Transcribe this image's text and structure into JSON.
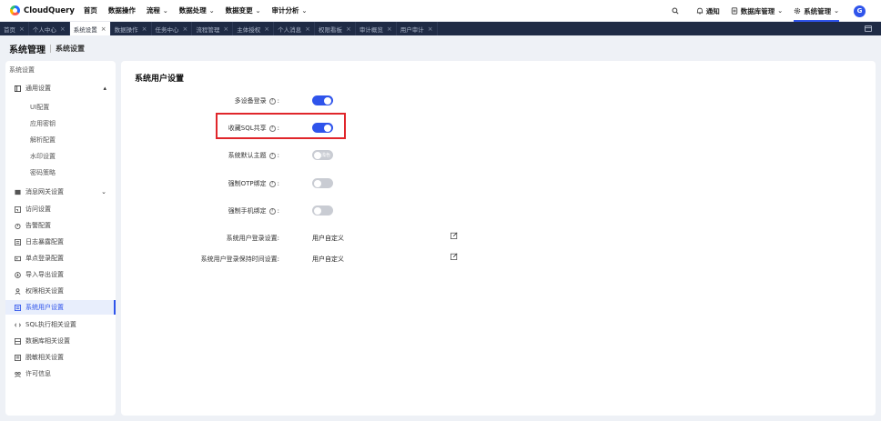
{
  "topnav": {
    "brand": "CloudQuery",
    "menu": [
      {
        "label": "首页",
        "caret": false
      },
      {
        "label": "数据操作",
        "caret": false
      },
      {
        "label": "流程",
        "caret": true
      },
      {
        "label": "数据处理",
        "caret": true
      },
      {
        "label": "数据变更",
        "caret": true
      },
      {
        "label": "审计分析",
        "caret": true
      }
    ],
    "notify": "通知",
    "db_manage": "数据库管理",
    "sys_manage": "系统管理",
    "avatar_letter": "G",
    "accent_color": "#2f54eb"
  },
  "tabs": [
    {
      "label": "首页",
      "active": false
    },
    {
      "label": "个人中心",
      "active": false
    },
    {
      "label": "系统设置",
      "active": true
    },
    {
      "label": "数据操作",
      "active": false
    },
    {
      "label": "任务中心",
      "active": false
    },
    {
      "label": "流程管理",
      "active": false
    },
    {
      "label": "主体授权",
      "active": false
    },
    {
      "label": "个人消息",
      "active": false
    },
    {
      "label": "权限看板",
      "active": false
    },
    {
      "label": "审计概览",
      "active": false
    },
    {
      "label": "用户审计",
      "active": false
    }
  ],
  "breadcrumb": {
    "section": "系统管理",
    "page": "系统设置"
  },
  "sidebar": {
    "title": "系统设置",
    "general": {
      "label": "通用设置",
      "expanded": true
    },
    "general_sub": [
      "UI配置",
      "应用密钥",
      "解析配置",
      "水印设置",
      "密码策略"
    ],
    "items": [
      {
        "label": "消息网关设置",
        "icon": "gateway-icon"
      },
      {
        "label": "访问设置",
        "icon": "access-icon"
      },
      {
        "label": "告警配置",
        "icon": "alarm-icon"
      },
      {
        "label": "日志暴露配置",
        "icon": "log-icon"
      },
      {
        "label": "单点登录配置",
        "icon": "sso-icon"
      },
      {
        "label": "导入导出设置",
        "icon": "import-export-icon"
      },
      {
        "label": "权限相关设置",
        "icon": "permission-icon"
      },
      {
        "label": "系统用户设置",
        "icon": "user-setting-icon",
        "active": true
      },
      {
        "label": "SQL执行相关设置",
        "icon": "sql-icon"
      },
      {
        "label": "数据库相关设置",
        "icon": "database-icon"
      },
      {
        "label": "脱敏相关设置",
        "icon": "desensitize-icon"
      },
      {
        "label": "许可信息",
        "icon": "license-icon"
      }
    ]
  },
  "main": {
    "title": "系统用户设置",
    "settings": [
      {
        "label": "多设备登录",
        "type": "toggle",
        "on": true
      },
      {
        "label": "收藏SQL共享",
        "type": "toggle",
        "on": true,
        "highlighted": true
      },
      {
        "label": "系统默认主题",
        "type": "toggle",
        "on": false,
        "toggle_text": "浅色"
      },
      {
        "label": "强制OTP绑定",
        "type": "toggle",
        "on": false
      },
      {
        "label": "强制手机绑定",
        "type": "toggle",
        "on": false
      },
      {
        "label": "系统用户登录设置:",
        "type": "value",
        "value": "用户自定义"
      },
      {
        "label": "系统用户登录保持时间设置:",
        "type": "value",
        "value": "用户自定义"
      }
    ],
    "help_mark": "?"
  }
}
